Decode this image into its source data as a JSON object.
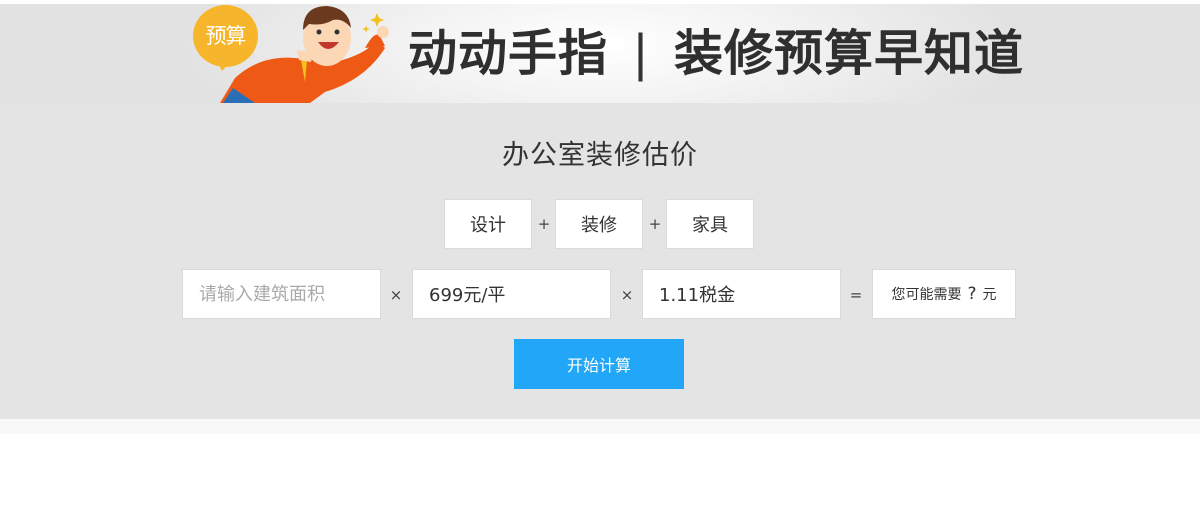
{
  "banner": {
    "badge_text": "预算",
    "slogan_left": "动动手指",
    "slogan_separator": "|",
    "slogan_right": "装修预算早知道"
  },
  "calculator": {
    "title": "办公室装修估价",
    "categories": [
      "设计",
      "装修",
      "家具"
    ],
    "plus_symbol": "+",
    "times_symbol": "×",
    "equals_symbol": "=",
    "area_placeholder": "请输入建筑面积",
    "area_value": "",
    "price_value": "699元/平",
    "tax_value": "1.11税金",
    "result_prefix": "您可能需要",
    "result_value": "?",
    "result_unit": "元",
    "button_label": "开始计算"
  },
  "colors": {
    "accent": "#22a6f7",
    "badge": "#f7b52b",
    "panel_bg": "#e4e4e4",
    "character_shirt": "#ee5a16"
  },
  "icons": {
    "character": "cartoon-man-illustration",
    "sparkle": "sparkle-stars"
  }
}
